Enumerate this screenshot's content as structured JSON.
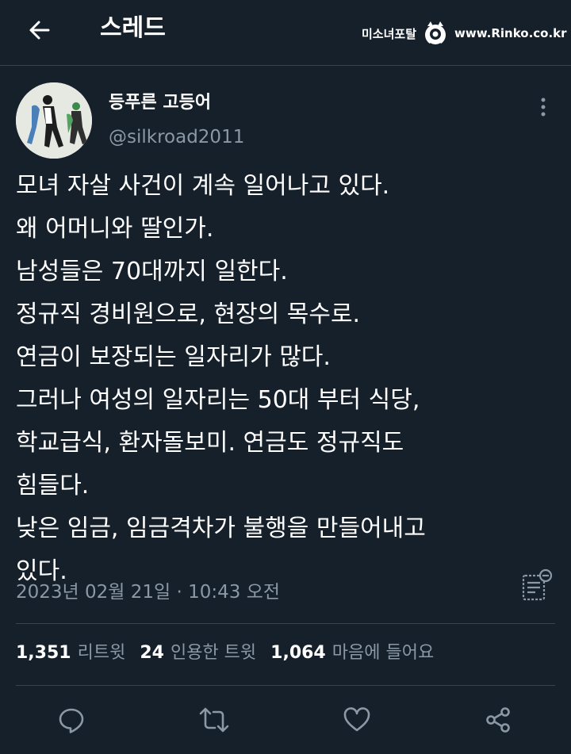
{
  "header": {
    "title": "스레드",
    "back_icon": "arrow-left-icon",
    "watermark_left": "미소녀포탈",
    "watermark_right": "www.Rinko.co.kr"
  },
  "tweet": {
    "author_name": "등푸른 고등어",
    "author_handle": "@silkroad2011",
    "text_lines": [
      "모녀 자살 사건이 계속 일어나고 있다.",
      "왜 어머니와 딸인가.",
      "남성들은 70대까지 일한다.",
      "정규직 경비원으로, 현장의 목수로.",
      "연금이 보장되는 일자리가 많다.",
      "그러나 여성의 일자리는 50대 부터 식당,",
      "학교급식, 환자돌보미. 연금도 정규직도",
      "힘들다.",
      "낮은 임금, 임금격차가 불행을 만들어내고",
      "있다."
    ],
    "timestamp": "2023년 02월 21일 · 10:43 오전"
  },
  "stats": {
    "retweets_count": "1,351",
    "retweets_label": "리트윗",
    "quotes_count": "24",
    "quotes_label": "인용한 트윗",
    "likes_count": "1,064",
    "likes_label": "마음에 들어요"
  },
  "actions": [
    "reply-icon",
    "retweet-icon",
    "like-icon",
    "share-icon"
  ],
  "colors": {
    "background": "#15202b",
    "secondary_text": "#8b98a5",
    "divider": "#38444d"
  }
}
